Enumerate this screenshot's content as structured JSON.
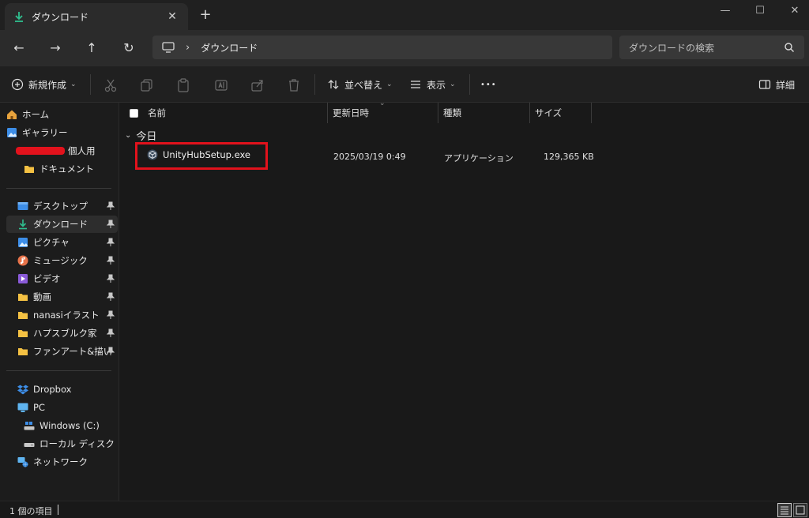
{
  "tab": {
    "title": "ダウンロード",
    "close": "✕",
    "new": "+"
  },
  "window": {
    "minimize": "—",
    "maximize": "☐",
    "close": "✕"
  },
  "nav": {
    "back": "←",
    "forward": "→",
    "up": "↑",
    "refresh": "↻"
  },
  "address": {
    "separator": "›",
    "location": "ダウンロード"
  },
  "search": {
    "placeholder": "ダウンロードの検索"
  },
  "commands": {
    "new_label": "新規作成",
    "sort_label": "並べ替え",
    "view_label": "表示",
    "more": "•••",
    "details_label": "詳細",
    "chevron": "⌄"
  },
  "sidebar": {
    "quick": [
      {
        "label": "ホーム",
        "icon": "home-icon"
      },
      {
        "label": "ギャラリー",
        "icon": "gallery-icon"
      },
      {
        "label": "個人用",
        "icon": "onedrive-icon"
      },
      {
        "label": "ドキュメント",
        "icon": "folder-icon"
      }
    ],
    "pinned": [
      {
        "label": "デスクトップ",
        "icon": "desktop-icon"
      },
      {
        "label": "ダウンロード",
        "icon": "download-icon"
      },
      {
        "label": "ピクチャ",
        "icon": "pictures-icon"
      },
      {
        "label": "ミュージック",
        "icon": "music-icon"
      },
      {
        "label": "ビデオ",
        "icon": "video-icon"
      },
      {
        "label": "動画",
        "icon": "folder-icon"
      },
      {
        "label": "nanasiイラスト",
        "icon": "folder-icon"
      },
      {
        "label": "ハプスブルク家",
        "icon": "folder-icon"
      },
      {
        "label": "ファンアート&描いて!",
        "icon": "folder-icon"
      }
    ],
    "drives": [
      {
        "label": "Dropbox",
        "icon": "dropbox-icon"
      },
      {
        "label": "PC",
        "icon": "pc-icon"
      },
      {
        "label": "Windows (C:)",
        "icon": "drive-icon"
      },
      {
        "label": "ローカル ディスク (D:)",
        "icon": "drive-icon"
      },
      {
        "label": "ネットワーク",
        "icon": "network-icon"
      }
    ]
  },
  "columns": {
    "name": "名前",
    "date": "更新日時",
    "type": "種類",
    "size": "サイズ"
  },
  "group": {
    "label": "今日"
  },
  "files": [
    {
      "name": "UnityHubSetup.exe",
      "date": "2025/03/19 0:49",
      "type": "アプリケーション",
      "size": "129,365 KB"
    }
  ],
  "status": {
    "count": "1 個の項目"
  },
  "colors": {
    "accent": "#e2121c",
    "folder": "#f4c143",
    "download": "#2fbf8f"
  }
}
